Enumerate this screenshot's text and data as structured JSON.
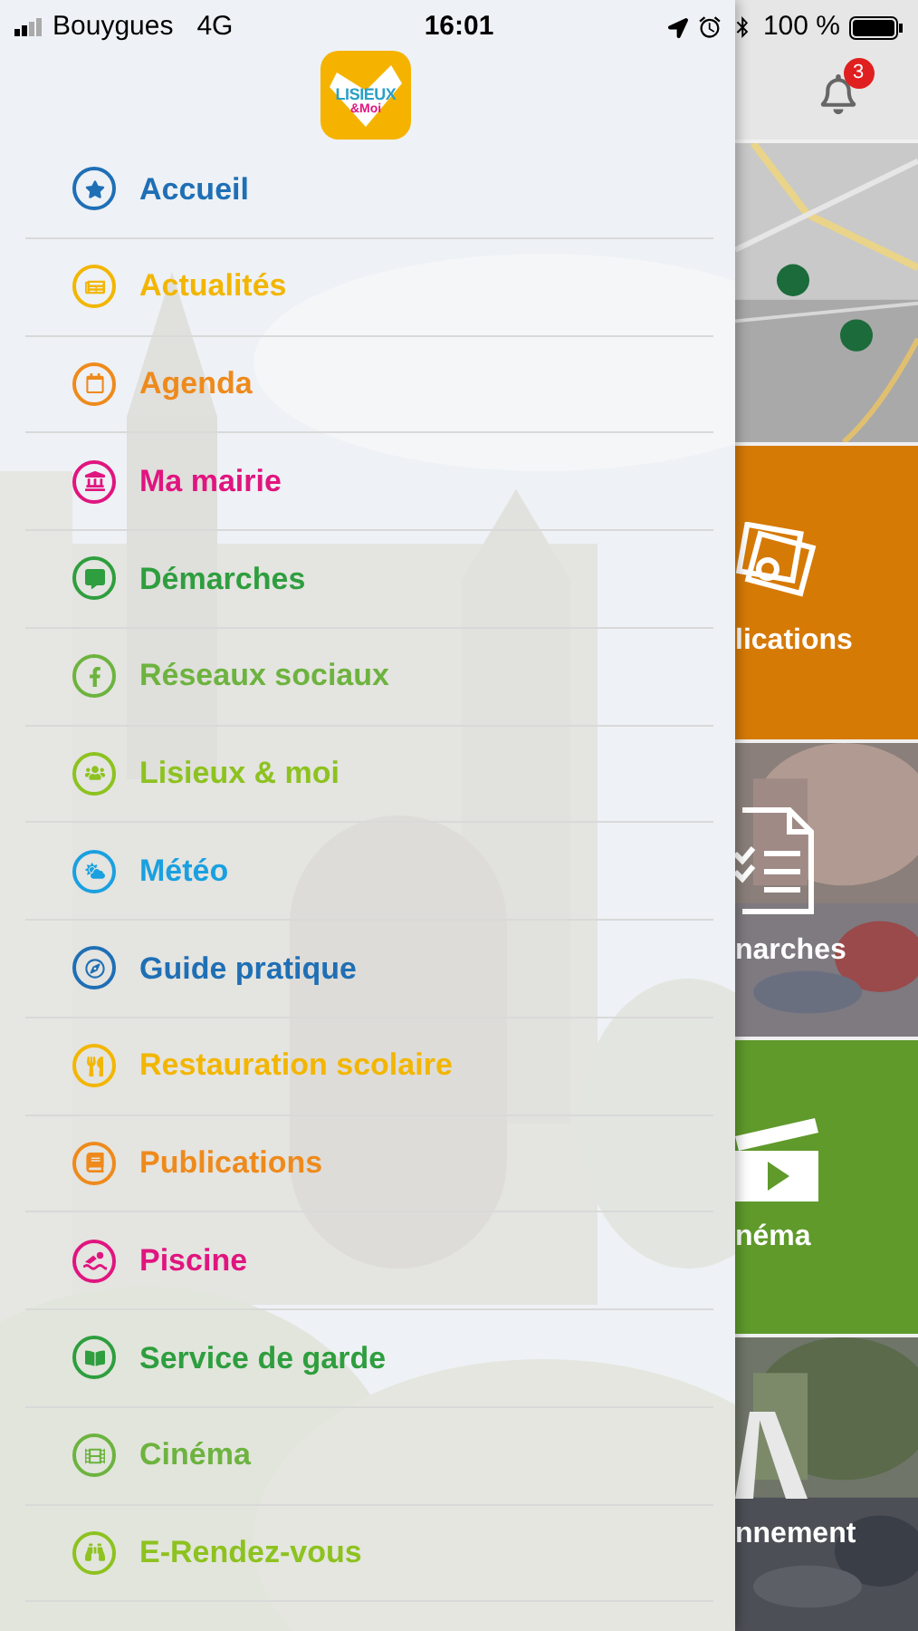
{
  "status_bar": {
    "carrier": "Bouygues",
    "network": "4G",
    "time": "16:01",
    "battery": "100 %"
  },
  "logo": {
    "line1": "LISIEUX",
    "line2": "&Moi"
  },
  "notifications": {
    "badge": "3"
  },
  "menu": [
    {
      "label": "Accueil",
      "kind": "star",
      "color": "#1f6fb5"
    },
    {
      "label": "Actualités",
      "kind": "news",
      "color": "#f2b600"
    },
    {
      "label": "Agenda",
      "kind": "calendar",
      "color": "#ee8a1c"
    },
    {
      "label": "Ma mairie",
      "kind": "townhall",
      "color": "#e0157f"
    },
    {
      "label": "Démarches",
      "kind": "comment",
      "color": "#2e9e3e"
    },
    {
      "label": "Réseaux sociaux",
      "kind": "facebook",
      "color": "#6db33f"
    },
    {
      "label": "Lisieux & moi",
      "kind": "users",
      "color": "#8dc21f"
    },
    {
      "label": "Météo",
      "kind": "weather",
      "color": "#1aa0e0"
    },
    {
      "label": "Guide pratique",
      "kind": "compass",
      "color": "#1f6fb5"
    },
    {
      "label": "Restauration scolaire",
      "kind": "cutlery",
      "color": "#f2b600"
    },
    {
      "label": "Publications",
      "kind": "book",
      "color": "#ee8a1c"
    },
    {
      "label": "Piscine",
      "kind": "swimmer",
      "color": "#e0157f"
    },
    {
      "label": "Service de garde",
      "kind": "openbook",
      "color": "#2e9e3e"
    },
    {
      "label": "Cinéma",
      "kind": "film",
      "color": "#6db33f"
    },
    {
      "label": "E-Rendez-vous",
      "kind": "binoculars",
      "color": "#8dc21f"
    }
  ],
  "tiles": [
    {
      "kind": "map"
    },
    {
      "kind": "solid",
      "label": "lications",
      "color": "#d67a06"
    },
    {
      "label": "narches"
    },
    {
      "kind": "solid",
      "label": "néma",
      "color": "#5f9a2b"
    },
    {
      "label": "nnement"
    }
  ]
}
